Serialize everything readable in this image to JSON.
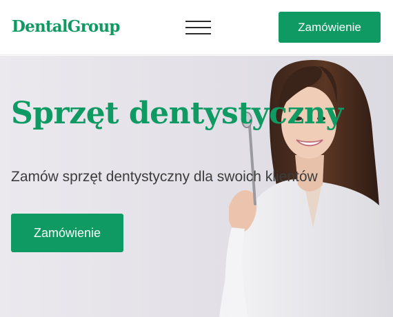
{
  "header": {
    "logo": "DentalGroup",
    "menu_icon": "hamburger-menu-icon",
    "order_button": "Zamówienie"
  },
  "hero": {
    "title": "Sprzęt dentystyczny",
    "subtitle": "Zamów sprzęt dentystyczny dla swoich klientów",
    "order_button": "Zamówienie",
    "image": "woman-holding-dental-mirror-photo"
  },
  "colors": {
    "brand_green": "#0e9a62",
    "text_dark": "#3c3c3c",
    "hero_background": "#e6e4ea"
  }
}
